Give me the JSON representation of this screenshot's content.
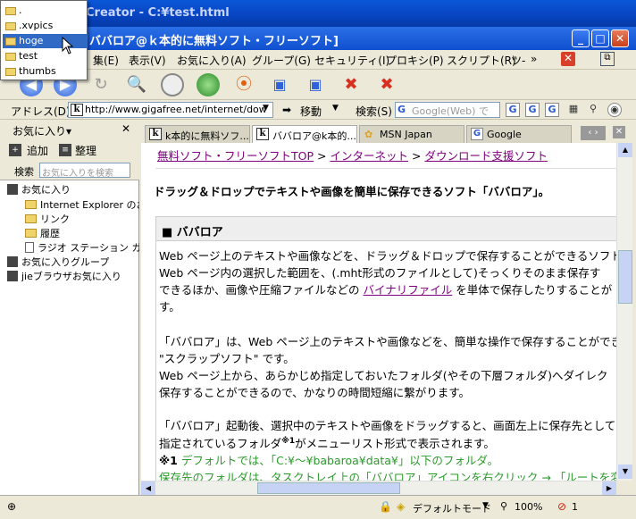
{
  "window": {
    "title_partial": "Creator - C:¥test.html",
    "page_title": "ババロア@ｋ本的に無料ソフト・フリーソフト]"
  },
  "popup_menu": {
    "items": [
      ".",
      ".xvpics",
      "hoge",
      "test",
      "thumbs"
    ],
    "selected_index": 2
  },
  "menubar": {
    "items": [
      "集(E)",
      "表示(V)",
      "お気に入り(A)",
      "グループ(G)",
      "セキュリティ(I)",
      "プロキシ(P)",
      "スクリプト(R)",
      "ツ-"
    ],
    "overflow": "»"
  },
  "address": {
    "label": "アドレス(D)",
    "url": "http://www.gigafree.net/internet/dow",
    "go_label": "移動",
    "search_label": "検索(S)",
    "search_placeholder": "Google(Web) で"
  },
  "sidebar": {
    "title": "お気に入り▾",
    "add_label": "追加",
    "organize_label": "整理",
    "search_label": "検索",
    "search_placeholder": "お気に入りを検索",
    "tree": [
      {
        "label": "お気に入り",
        "level": 0
      },
      {
        "label": "Internet Explorer のお",
        "level": 1
      },
      {
        "label": "リンク",
        "level": 1
      },
      {
        "label": "履歴",
        "level": 1
      },
      {
        "label": "ラジオ ステーション ガイ",
        "level": 1
      },
      {
        "label": "お気に入りグループ",
        "level": 0
      },
      {
        "label": "jieブラウザお気に入り",
        "level": 0
      }
    ]
  },
  "tabs": [
    {
      "label": "k本的に無料ソフ...",
      "active": false
    },
    {
      "label": "ババロア@k本的...",
      "active": true
    },
    {
      "label": "MSN Japan",
      "active": false
    },
    {
      "label": "Google",
      "active": false
    }
  ],
  "content": {
    "breadcrumb": [
      "無料ソフト・フリーソフトTOP",
      "インターネット",
      "ダウンロード支援ソフト"
    ],
    "sep": ">",
    "heading": "ドラッグ＆ドロップでテキストや画像を簡単に保存できるソフト「ババロア」。",
    "section_title": "■ ババロア",
    "para1": [
      "Web ページ上のテキストや画像などを、ドラッグ＆ドロップで保存することができるソフト。",
      "Web ページ内の選択した範囲を、(.mht形式のファイルとして)そっくりそのまま保存す",
      "できるほか、画像や圧縮ファイルなどの",
      "バイナリファイル",
      "を単体で保存したりすることが",
      "す。"
    ],
    "para2": [
      "「ババロア」は、Web ページ上のテキストや画像などを、簡単な操作で保存することができ",
      "\"スクラップソフト\" です。",
      "Web ページ上から、あらかじめ指定しておいたフォルダ(やその下層フォルダ)へダイレク",
      "保存することができるので、かなりの時間短縮に繋がります。"
    ],
    "para3": [
      "「ババロア」起動後、選択中のテキストや画像をドラッグすると、画面左上に保存先として",
      "指定されているフォルダ",
      "※1",
      "がメニューリスト形式で表示されます。"
    ],
    "note": [
      "※1",
      "デフォルトでは、「C:¥〜¥babaroa¥data¥」以下のフォルダ。",
      "保存先のフォルダは、タスクトレイ上の「ババロア」アイコンを右クリック → 「ルートを変更"
    ]
  },
  "status": {
    "mode": "デフォルトモード",
    "zoom": "100%",
    "blocked": "1"
  },
  "colors": {
    "title": "#0846c4",
    "link": "#800080",
    "note_green": "#2a9a2a",
    "selection": "#316ac5"
  }
}
